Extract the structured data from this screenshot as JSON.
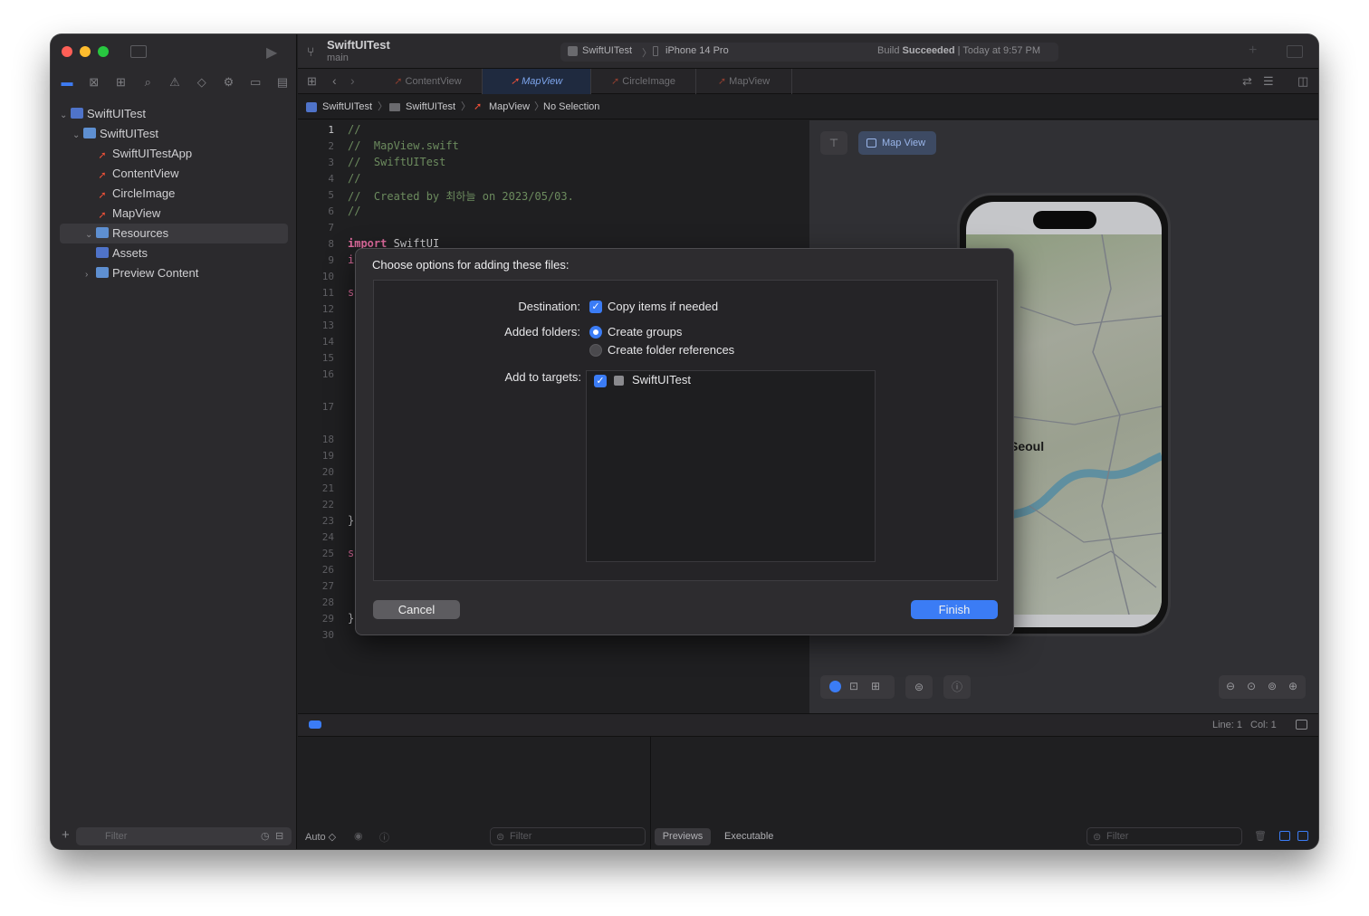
{
  "project": {
    "name": "SwiftUITest",
    "branch": "main"
  },
  "scheme": {
    "target": "SwiftUITest",
    "device": "iPhone 14 Pro"
  },
  "build_status": {
    "result": "Succeeded",
    "prefix": "Build",
    "time": "Today at 9:57 PM"
  },
  "tree": {
    "root": "SwiftUITest",
    "group": "SwiftUITest",
    "files": [
      "SwiftUITestApp",
      "ContentView",
      "CircleImage",
      "MapView"
    ],
    "resources": "Resources",
    "assets": "Assets",
    "preview": "Preview Content"
  },
  "tabs": [
    "ContentView",
    "MapView",
    "CircleImage",
    "MapView"
  ],
  "jumpbar": {
    "project": "SwiftUITest",
    "folder": "SwiftUITest",
    "file": "MapView",
    "selection": "No Selection"
  },
  "code": {
    "lines": [
      "1",
      "2",
      "3",
      "4",
      "5",
      "6",
      "7",
      "8",
      "9",
      "10",
      "11",
      "12",
      "13",
      "14",
      "15",
      "16",
      "17",
      "18",
      "19",
      "20",
      "21",
      "22",
      "23",
      "24",
      "25",
      "26",
      "27",
      "28",
      "29",
      "30"
    ],
    "l1": "//",
    "l2": "//  MapView.swift",
    "l3": "//  SwiftUITest",
    "l4": "//",
    "l5": "//  Created by 최하늘 on 2023/05/03.",
    "l6": "//",
    "l8_kw": "import",
    "l8_mod": "SwiftUI",
    "l9": "i",
    "l11": "s",
    "l23": "}",
    "l25": "s",
    "l29": "}"
  },
  "preview": {
    "label": "Map View",
    "map_city": "Seoul"
  },
  "status": {
    "line": "Line: 1",
    "col": "Col: 1"
  },
  "bottom": {
    "auto": "Auto ◇",
    "filter": "Filter",
    "previews": "Previews",
    "executable": "Executable"
  },
  "dialog": {
    "title": "Choose options for adding these files:",
    "destination_label": "Destination:",
    "copy_items": "Copy items if needed",
    "added_folders_label": "Added folders:",
    "create_groups": "Create groups",
    "create_folder_refs": "Create folder references",
    "add_targets_label": "Add to targets:",
    "target_name": "SwiftUITest",
    "cancel": "Cancel",
    "finish": "Finish"
  },
  "colors": {
    "accent": "#3b7cf5",
    "swift": "#f05138"
  }
}
